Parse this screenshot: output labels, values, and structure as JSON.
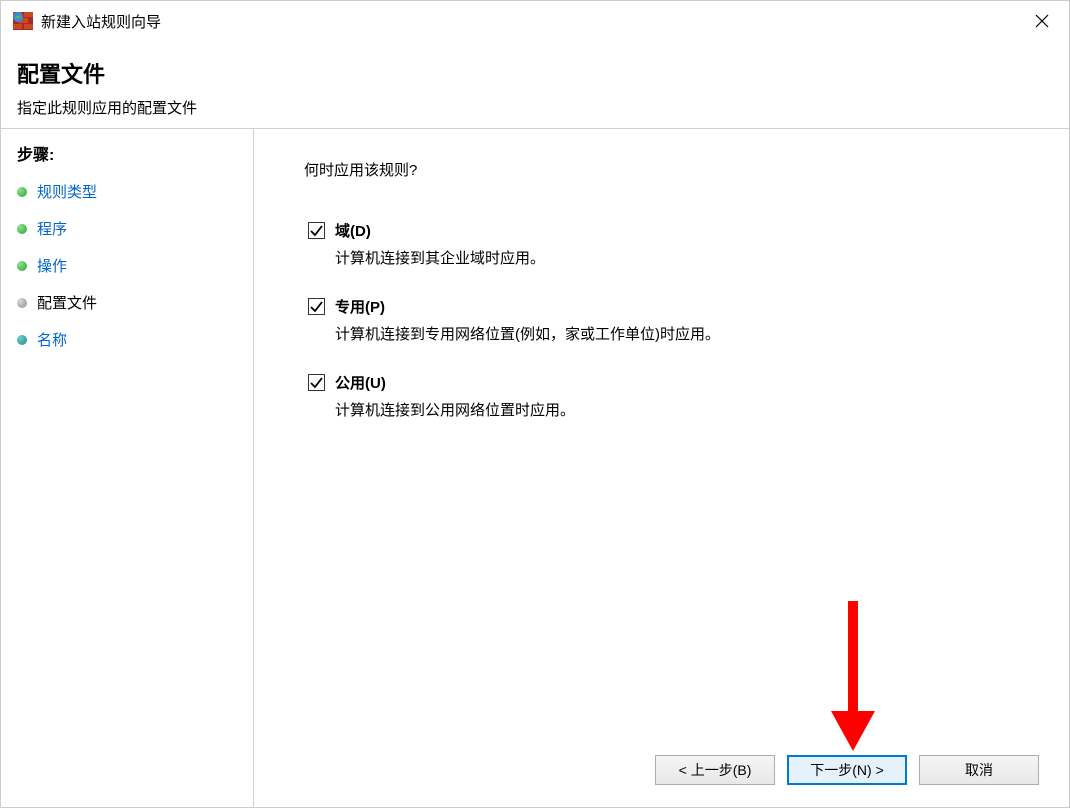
{
  "titlebar": {
    "title": "新建入站规则向导"
  },
  "header": {
    "title": "配置文件",
    "subtitle": "指定此规则应用的配置文件"
  },
  "sidebar": {
    "header": "步骤:",
    "items": [
      {
        "label": "规则类型",
        "bullet": "green",
        "current": false
      },
      {
        "label": "程序",
        "bullet": "green",
        "current": false
      },
      {
        "label": "操作",
        "bullet": "green",
        "current": false
      },
      {
        "label": "配置文件",
        "bullet": "grey",
        "current": true
      },
      {
        "label": "名称",
        "bullet": "teal",
        "current": false
      }
    ]
  },
  "main": {
    "prompt": "何时应用该规则?",
    "options": [
      {
        "label": "域(D)",
        "desc": "计算机连接到其企业域时应用。",
        "checked": true
      },
      {
        "label": "专用(P)",
        "desc": "计算机连接到专用网络位置(例如，家或工作单位)时应用。",
        "checked": true
      },
      {
        "label": "公用(U)",
        "desc": "计算机连接到公用网络位置时应用。",
        "checked": true
      }
    ]
  },
  "buttons": {
    "back": "< 上一步(B)",
    "next": "下一步(N) >",
    "cancel": "取消"
  },
  "annotation": {
    "arrow_color": "#ff0000"
  }
}
